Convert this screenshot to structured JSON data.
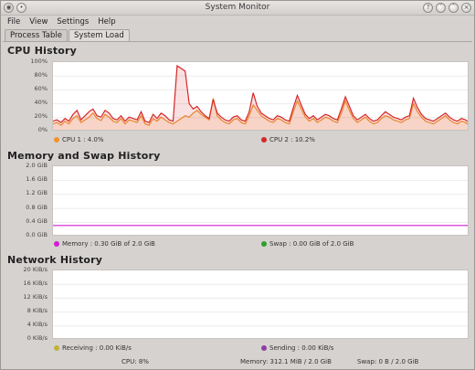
{
  "window": {
    "title": "System Monitor"
  },
  "menu": {
    "file": "File",
    "view": "View",
    "settings": "Settings",
    "help": "Help"
  },
  "tabs": {
    "process_table": "Process Table",
    "system_load": "System Load"
  },
  "cpu": {
    "title": "CPU History",
    "y_ticks": [
      "100%",
      "80%",
      "60%",
      "40%",
      "20%",
      "0%"
    ],
    "legend": [
      {
        "label": "CPU 1 : 4.0%",
        "color": "#f0932b"
      },
      {
        "label": "CPU 2 : 10.2%",
        "color": "#d62728"
      }
    ]
  },
  "memory": {
    "title": "Memory and Swap History",
    "y_ticks": [
      "2.0 GiB",
      "1.6 GiB",
      "1.2 GiB",
      "0.8 GiB",
      "0.4 GiB",
      "0.0 GiB"
    ],
    "legend": [
      {
        "label": "Memory : 0.30 GiB of 2.0 GiB",
        "color": "#d41bd4"
      },
      {
        "label": "Swap : 0.00 GiB of 2.0 GiB",
        "color": "#2ca02c"
      }
    ]
  },
  "network": {
    "title": "Network History",
    "y_ticks": [
      "20 KiB/s",
      "16 KiB/s",
      "12 KiB/s",
      "8 KiB/s",
      "4 KiB/s",
      "0 KiB/s"
    ],
    "legend": [
      {
        "label": "Receiving : 0.00 KiB/s",
        "color": "#bfb237"
      },
      {
        "label": "Sending : 0.00 KiB/s",
        "color": "#8e3fa8"
      }
    ]
  },
  "status": {
    "cpu": "CPU: 8%",
    "memory": "Memory: 312.1 MiB / 2.0 GiB",
    "swap": "Swap: 0 B / 2.0 GiB"
  },
  "chart_data": [
    {
      "type": "area",
      "title": "CPU History",
      "ylim": [
        0,
        100
      ],
      "series": [
        {
          "name": "CPU 1",
          "color": "#f0932b",
          "values": [
            10,
            12,
            8,
            14,
            10,
            18,
            22,
            12,
            16,
            20,
            26,
            18,
            15,
            24,
            20,
            14,
            12,
            18,
            10,
            16,
            14,
            12,
            22,
            10,
            8,
            18,
            14,
            20,
            16,
            12,
            10,
            14,
            18,
            22,
            20,
            26,
            30,
            24,
            20,
            16,
            48,
            22,
            16,
            12,
            10,
            16,
            18,
            12,
            10,
            22,
            38,
            30,
            22,
            18,
            14,
            12,
            18,
            16,
            12,
            10,
            28,
            44,
            32,
            20,
            14,
            18,
            12,
            16,
            20,
            18,
            14,
            12,
            26,
            44,
            30,
            18,
            12,
            16,
            20,
            14,
            10,
            12,
            18,
            22,
            20,
            16,
            14,
            12,
            16,
            18,
            40,
            28,
            20,
            14,
            12,
            10,
            14,
            18,
            22,
            16,
            12,
            10,
            14,
            12,
            8
          ]
        },
        {
          "name": "CPU 2",
          "color": "#d62728",
          "values": [
            14,
            16,
            12,
            18,
            14,
            24,
            30,
            16,
            22,
            28,
            32,
            22,
            20,
            30,
            26,
            18,
            16,
            22,
            14,
            20,
            18,
            16,
            28,
            14,
            12,
            24,
            18,
            26,
            22,
            16,
            14,
            96,
            92,
            88,
            40,
            32,
            36,
            28,
            22,
            18,
            46,
            26,
            20,
            16,
            14,
            20,
            22,
            16,
            14,
            28,
            56,
            36,
            26,
            22,
            18,
            16,
            22,
            20,
            16,
            14,
            34,
            52,
            38,
            24,
            18,
            22,
            16,
            20,
            24,
            22,
            18,
            16,
            32,
            50,
            36,
            22,
            16,
            20,
            24,
            18,
            14,
            16,
            22,
            28,
            24,
            20,
            18,
            16,
            20,
            22,
            48,
            34,
            24,
            18,
            16,
            14,
            18,
            22,
            26,
            20,
            16,
            14,
            18,
            16,
            12
          ]
        }
      ]
    },
    {
      "type": "line",
      "title": "Memory and Swap History",
      "ylim": [
        0,
        2.0
      ],
      "series": [
        {
          "name": "Memory",
          "color": "#d41bd4",
          "values": [
            0.3,
            0.3,
            0.3,
            0.3,
            0.3,
            0.3,
            0.3,
            0.3,
            0.3,
            0.3
          ]
        },
        {
          "name": "Swap",
          "color": "#2ca02c",
          "values": [
            0.0,
            0.0,
            0.0,
            0.0,
            0.0,
            0.0,
            0.0,
            0.0,
            0.0,
            0.0
          ]
        }
      ]
    },
    {
      "type": "line",
      "title": "Network History",
      "ylim": [
        0,
        20
      ],
      "series": [
        {
          "name": "Receiving",
          "color": "#bfb237",
          "values": [
            0,
            0,
            0,
            0,
            0,
            0,
            0,
            0,
            0,
            0
          ]
        },
        {
          "name": "Sending",
          "color": "#8e3fa8",
          "values": [
            0,
            0,
            0,
            0,
            0,
            0,
            0,
            0,
            0,
            0
          ]
        }
      ]
    }
  ]
}
